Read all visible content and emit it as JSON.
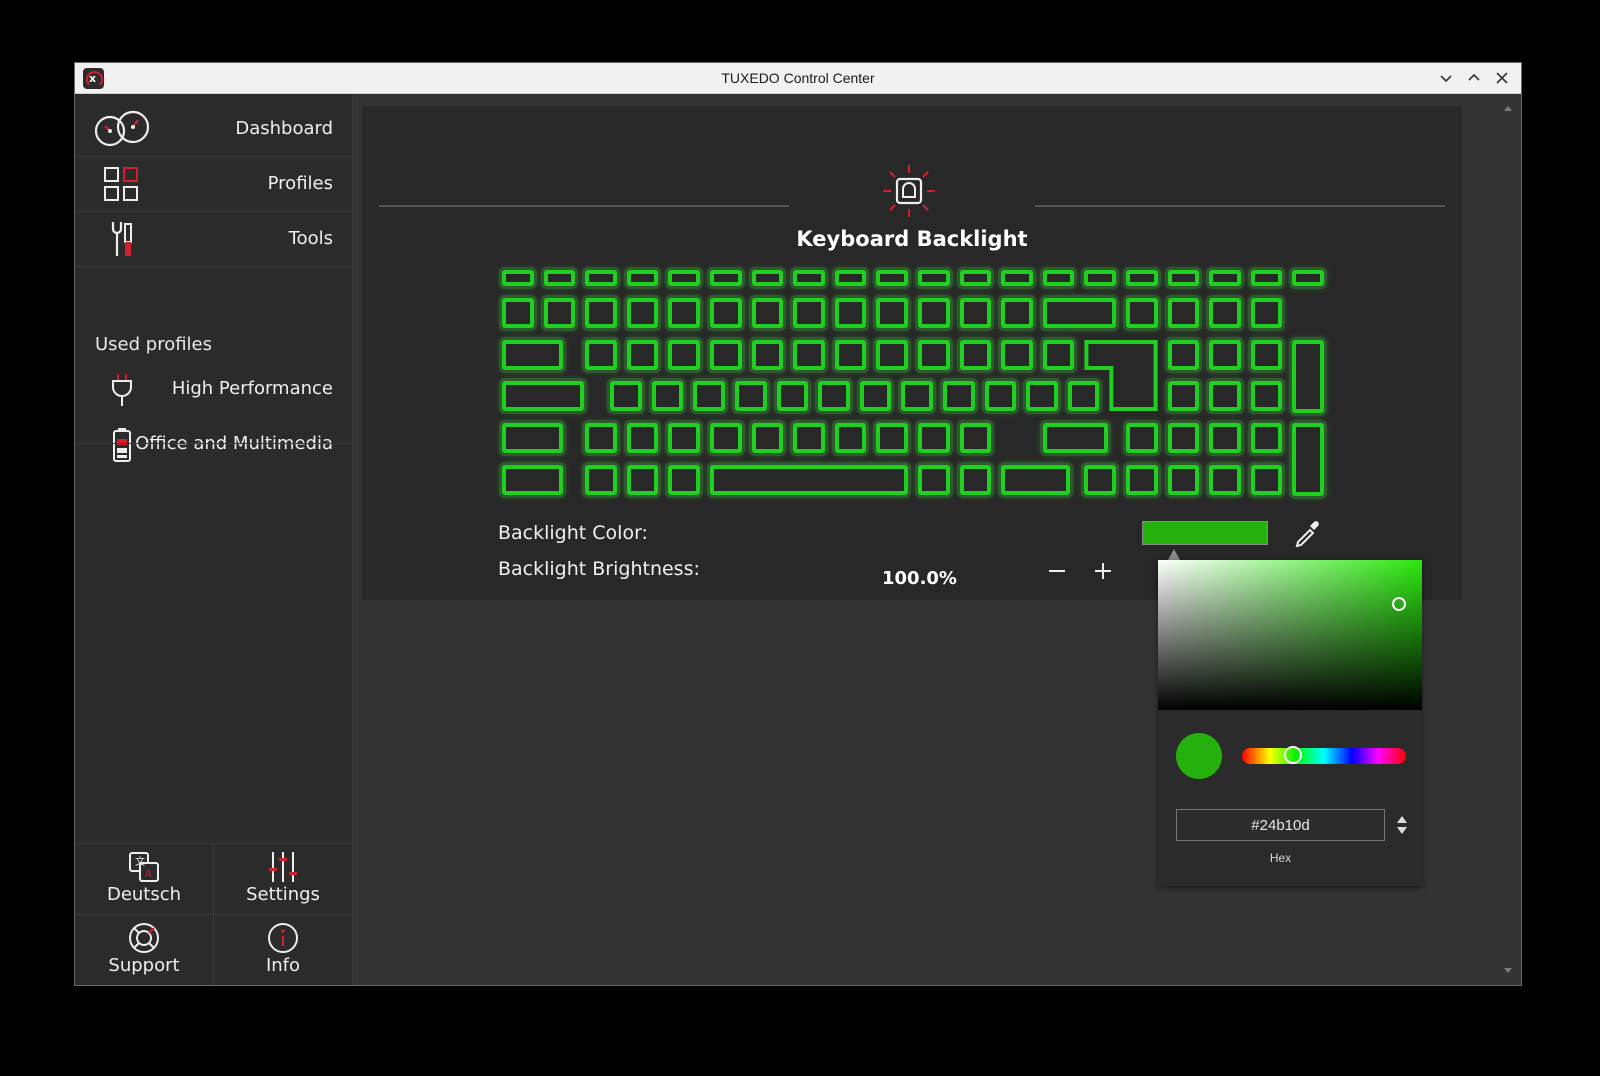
{
  "window": {
    "title": "TUXEDO Control Center",
    "icons": {
      "app": "tuxedo-logo-icon",
      "minimize": "chevron-down-icon",
      "maximize": "chevron-up-icon",
      "close": "close-icon"
    }
  },
  "sidebar": {
    "nav": [
      {
        "label": "Dashboard",
        "icon": "speedometer-icon"
      },
      {
        "label": "Profiles",
        "icon": "grid-icon"
      },
      {
        "label": "Tools",
        "icon": "tools-icon"
      }
    ],
    "used_profiles_label": "Used profiles",
    "profiles": [
      {
        "label": "High Performance",
        "icon": "power-plug-icon"
      },
      {
        "label": "Office and Multimedia",
        "icon": "battery-icon"
      }
    ],
    "bottom": [
      {
        "label": "Deutsch",
        "icon": "translate-icon"
      },
      {
        "label": "Settings",
        "icon": "sliders-icon"
      },
      {
        "label": "Support",
        "icon": "lifebuoy-icon"
      },
      {
        "label": "Info",
        "icon": "info-icon"
      }
    ]
  },
  "keyboard_backlight": {
    "title": "Keyboard Backlight",
    "icon": "keyboard-backlight-icon",
    "color_label": "Backlight Color:",
    "brightness_label": "Backlight Brightness:",
    "brightness_value": "100.0%",
    "key_color": "#20d020",
    "icons": {
      "decrease": "minus-icon",
      "increase": "plus-icon",
      "eyedropper": "eyedropper-icon"
    }
  },
  "color_picker": {
    "hex_value": "#24b10d",
    "hex_label": "Hex",
    "selected_color": "#24b10d",
    "icons": {
      "format_toggle": "up-down-arrows-icon"
    }
  }
}
